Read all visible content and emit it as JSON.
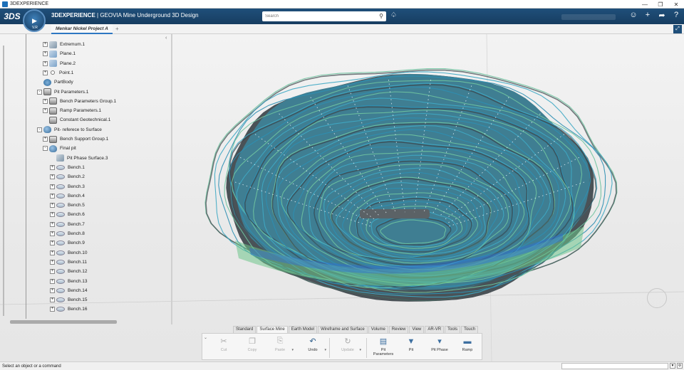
{
  "window": {
    "title": "3DEXPERIENCE"
  },
  "appbar": {
    "brand_bold": "3DEXPERIENCE",
    "brand_rest": " | GEOVIA  Mine Underground 3D Design",
    "compass_version": "V.R",
    "search": {
      "placeholder": "Search"
    }
  },
  "tabs": [
    {
      "label": "Menkar Nickel Project A"
    }
  ],
  "tree": {
    "items": [
      {
        "label": "Extremum.1",
        "icon": "geo",
        "level": 2,
        "toggle": "+"
      },
      {
        "label": "Plane.1",
        "icon": "plane",
        "level": 2,
        "toggle": "+"
      },
      {
        "label": "Plane.2",
        "icon": "plane",
        "level": 2,
        "toggle": "+"
      },
      {
        "label": "Point.1",
        "icon": "point",
        "level": 2,
        "toggle": "+"
      },
      {
        "label": "PartBody",
        "icon": "body",
        "level": 1,
        "toggle": ""
      },
      {
        "label": "Pit Parameters.1",
        "icon": "param",
        "level": 1,
        "toggle": "-"
      },
      {
        "label": "Bench Parameters Group.1",
        "icon": "param",
        "level": 2,
        "toggle": "+"
      },
      {
        "label": "Ramp Parameters.1",
        "icon": "param",
        "level": 2,
        "toggle": "+"
      },
      {
        "label": "Constant Geotechnical.1",
        "icon": "param",
        "level": 2,
        "toggle": ""
      },
      {
        "label": "Pit- referece to Surface",
        "icon": "surf",
        "level": 1,
        "toggle": "-"
      },
      {
        "label": "Bench Support Group.1",
        "icon": "param",
        "level": 2,
        "toggle": "+"
      },
      {
        "label": "Final pit",
        "icon": "surf",
        "level": 2,
        "toggle": "-"
      },
      {
        "label": "Pit Phase Surface.3",
        "icon": "geo",
        "level": 3,
        "toggle": ""
      },
      {
        "label": "Bench.1",
        "icon": "bench",
        "level": 3,
        "toggle": "+"
      },
      {
        "label": "Bench.2",
        "icon": "bench",
        "level": 3,
        "toggle": "+"
      },
      {
        "label": "Bench.3",
        "icon": "bench",
        "level": 3,
        "toggle": "+"
      },
      {
        "label": "Bench.4",
        "icon": "bench",
        "level": 3,
        "toggle": "+"
      },
      {
        "label": "Bench.5",
        "icon": "bench",
        "level": 3,
        "toggle": "+"
      },
      {
        "label": "Bench.6",
        "icon": "bench",
        "level": 3,
        "toggle": "+"
      },
      {
        "label": "Bench.7",
        "icon": "bench",
        "level": 3,
        "toggle": "+"
      },
      {
        "label": "Bench.8",
        "icon": "bench",
        "level": 3,
        "toggle": "+"
      },
      {
        "label": "Bench.9",
        "icon": "bench",
        "level": 3,
        "toggle": "+"
      },
      {
        "label": "Bench.10",
        "icon": "bench",
        "level": 3,
        "toggle": "+"
      },
      {
        "label": "Bench.11",
        "icon": "bench",
        "level": 3,
        "toggle": "+"
      },
      {
        "label": "Bench.12",
        "icon": "bench",
        "level": 3,
        "toggle": "+"
      },
      {
        "label": "Bench.13",
        "icon": "bench",
        "level": 3,
        "toggle": "+"
      },
      {
        "label": "Bench.14",
        "icon": "bench",
        "level": 3,
        "toggle": "+"
      },
      {
        "label": "Bench.15",
        "icon": "bench",
        "level": 3,
        "toggle": "+"
      },
      {
        "label": "Bench.16",
        "icon": "bench",
        "level": 3,
        "toggle": "+"
      }
    ]
  },
  "section_tabs": [
    {
      "label": "Standard",
      "active": false
    },
    {
      "label": "Surface Mine",
      "active": true
    },
    {
      "label": "Earth Model",
      "active": false
    },
    {
      "label": "Wireframe and Surface",
      "active": false
    },
    {
      "label": "Volume",
      "active": false
    },
    {
      "label": "Review",
      "active": false
    },
    {
      "label": "View",
      "active": false
    },
    {
      "label": "AR-VR",
      "active": false
    },
    {
      "label": "Tools",
      "active": false
    },
    {
      "label": "Touch",
      "active": false
    }
  ],
  "actions": [
    {
      "label": "Cut",
      "icon": "scissors-icon",
      "enabled": false
    },
    {
      "label": "Copy",
      "icon": "copy-icon",
      "enabled": false
    },
    {
      "label": "Paste",
      "icon": "paste-icon",
      "enabled": false
    },
    {
      "label": "Undo",
      "icon": "undo-icon",
      "enabled": true
    },
    {
      "label": "Update",
      "icon": "update-icon",
      "enabled": false
    },
    {
      "label": "Pit Parameters",
      "icon": "pit-parameters-icon",
      "enabled": true
    },
    {
      "label": "Pit",
      "icon": "pit-icon",
      "enabled": true
    },
    {
      "label": "Pit Phase",
      "icon": "pit-phase-icon",
      "enabled": true
    },
    {
      "label": "Ramp",
      "icon": "ramp-icon",
      "enabled": true
    }
  ],
  "status": {
    "text": "Select an object or a command"
  },
  "colors": {
    "accent": "#2d77c2",
    "topbar": "#1f4f7a",
    "pit_dark": "#3e4a52",
    "pit_contour": "#3fa9c4",
    "pit_green": "#9bd66a"
  }
}
